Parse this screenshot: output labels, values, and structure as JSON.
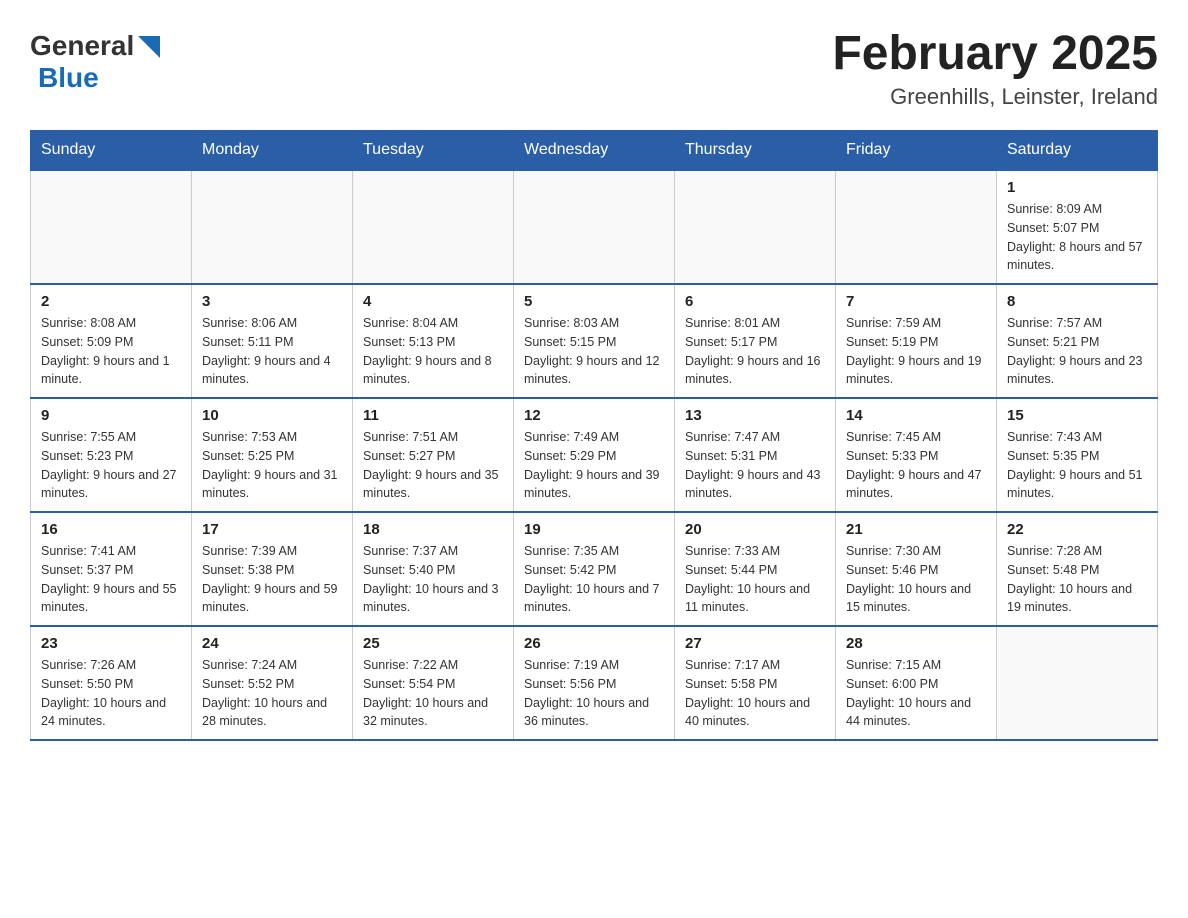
{
  "header": {
    "logo_general": "General",
    "logo_blue": "Blue",
    "month_year": "February 2025",
    "location": "Greenhills, Leinster, Ireland"
  },
  "days_of_week": [
    "Sunday",
    "Monday",
    "Tuesday",
    "Wednesday",
    "Thursday",
    "Friday",
    "Saturday"
  ],
  "weeks": [
    {
      "days": [
        {
          "num": "",
          "sunrise": "",
          "sunset": "",
          "daylight": ""
        },
        {
          "num": "",
          "sunrise": "",
          "sunset": "",
          "daylight": ""
        },
        {
          "num": "",
          "sunrise": "",
          "sunset": "",
          "daylight": ""
        },
        {
          "num": "",
          "sunrise": "",
          "sunset": "",
          "daylight": ""
        },
        {
          "num": "",
          "sunrise": "",
          "sunset": "",
          "daylight": ""
        },
        {
          "num": "",
          "sunrise": "",
          "sunset": "",
          "daylight": ""
        },
        {
          "num": "1",
          "sunrise": "Sunrise: 8:09 AM",
          "sunset": "Sunset: 5:07 PM",
          "daylight": "Daylight: 8 hours and 57 minutes."
        }
      ]
    },
    {
      "days": [
        {
          "num": "2",
          "sunrise": "Sunrise: 8:08 AM",
          "sunset": "Sunset: 5:09 PM",
          "daylight": "Daylight: 9 hours and 1 minute."
        },
        {
          "num": "3",
          "sunrise": "Sunrise: 8:06 AM",
          "sunset": "Sunset: 5:11 PM",
          "daylight": "Daylight: 9 hours and 4 minutes."
        },
        {
          "num": "4",
          "sunrise": "Sunrise: 8:04 AM",
          "sunset": "Sunset: 5:13 PM",
          "daylight": "Daylight: 9 hours and 8 minutes."
        },
        {
          "num": "5",
          "sunrise": "Sunrise: 8:03 AM",
          "sunset": "Sunset: 5:15 PM",
          "daylight": "Daylight: 9 hours and 12 minutes."
        },
        {
          "num": "6",
          "sunrise": "Sunrise: 8:01 AM",
          "sunset": "Sunset: 5:17 PM",
          "daylight": "Daylight: 9 hours and 16 minutes."
        },
        {
          "num": "7",
          "sunrise": "Sunrise: 7:59 AM",
          "sunset": "Sunset: 5:19 PM",
          "daylight": "Daylight: 9 hours and 19 minutes."
        },
        {
          "num": "8",
          "sunrise": "Sunrise: 7:57 AM",
          "sunset": "Sunset: 5:21 PM",
          "daylight": "Daylight: 9 hours and 23 minutes."
        }
      ]
    },
    {
      "days": [
        {
          "num": "9",
          "sunrise": "Sunrise: 7:55 AM",
          "sunset": "Sunset: 5:23 PM",
          "daylight": "Daylight: 9 hours and 27 minutes."
        },
        {
          "num": "10",
          "sunrise": "Sunrise: 7:53 AM",
          "sunset": "Sunset: 5:25 PM",
          "daylight": "Daylight: 9 hours and 31 minutes."
        },
        {
          "num": "11",
          "sunrise": "Sunrise: 7:51 AM",
          "sunset": "Sunset: 5:27 PM",
          "daylight": "Daylight: 9 hours and 35 minutes."
        },
        {
          "num": "12",
          "sunrise": "Sunrise: 7:49 AM",
          "sunset": "Sunset: 5:29 PM",
          "daylight": "Daylight: 9 hours and 39 minutes."
        },
        {
          "num": "13",
          "sunrise": "Sunrise: 7:47 AM",
          "sunset": "Sunset: 5:31 PM",
          "daylight": "Daylight: 9 hours and 43 minutes."
        },
        {
          "num": "14",
          "sunrise": "Sunrise: 7:45 AM",
          "sunset": "Sunset: 5:33 PM",
          "daylight": "Daylight: 9 hours and 47 minutes."
        },
        {
          "num": "15",
          "sunrise": "Sunrise: 7:43 AM",
          "sunset": "Sunset: 5:35 PM",
          "daylight": "Daylight: 9 hours and 51 minutes."
        }
      ]
    },
    {
      "days": [
        {
          "num": "16",
          "sunrise": "Sunrise: 7:41 AM",
          "sunset": "Sunset: 5:37 PM",
          "daylight": "Daylight: 9 hours and 55 minutes."
        },
        {
          "num": "17",
          "sunrise": "Sunrise: 7:39 AM",
          "sunset": "Sunset: 5:38 PM",
          "daylight": "Daylight: 9 hours and 59 minutes."
        },
        {
          "num": "18",
          "sunrise": "Sunrise: 7:37 AM",
          "sunset": "Sunset: 5:40 PM",
          "daylight": "Daylight: 10 hours and 3 minutes."
        },
        {
          "num": "19",
          "sunrise": "Sunrise: 7:35 AM",
          "sunset": "Sunset: 5:42 PM",
          "daylight": "Daylight: 10 hours and 7 minutes."
        },
        {
          "num": "20",
          "sunrise": "Sunrise: 7:33 AM",
          "sunset": "Sunset: 5:44 PM",
          "daylight": "Daylight: 10 hours and 11 minutes."
        },
        {
          "num": "21",
          "sunrise": "Sunrise: 7:30 AM",
          "sunset": "Sunset: 5:46 PM",
          "daylight": "Daylight: 10 hours and 15 minutes."
        },
        {
          "num": "22",
          "sunrise": "Sunrise: 7:28 AM",
          "sunset": "Sunset: 5:48 PM",
          "daylight": "Daylight: 10 hours and 19 minutes."
        }
      ]
    },
    {
      "days": [
        {
          "num": "23",
          "sunrise": "Sunrise: 7:26 AM",
          "sunset": "Sunset: 5:50 PM",
          "daylight": "Daylight: 10 hours and 24 minutes."
        },
        {
          "num": "24",
          "sunrise": "Sunrise: 7:24 AM",
          "sunset": "Sunset: 5:52 PM",
          "daylight": "Daylight: 10 hours and 28 minutes."
        },
        {
          "num": "25",
          "sunrise": "Sunrise: 7:22 AM",
          "sunset": "Sunset: 5:54 PM",
          "daylight": "Daylight: 10 hours and 32 minutes."
        },
        {
          "num": "26",
          "sunrise": "Sunrise: 7:19 AM",
          "sunset": "Sunset: 5:56 PM",
          "daylight": "Daylight: 10 hours and 36 minutes."
        },
        {
          "num": "27",
          "sunrise": "Sunrise: 7:17 AM",
          "sunset": "Sunset: 5:58 PM",
          "daylight": "Daylight: 10 hours and 40 minutes."
        },
        {
          "num": "28",
          "sunrise": "Sunrise: 7:15 AM",
          "sunset": "Sunset: 6:00 PM",
          "daylight": "Daylight: 10 hours and 44 minutes."
        },
        {
          "num": "",
          "sunrise": "",
          "sunset": "",
          "daylight": ""
        }
      ]
    }
  ]
}
